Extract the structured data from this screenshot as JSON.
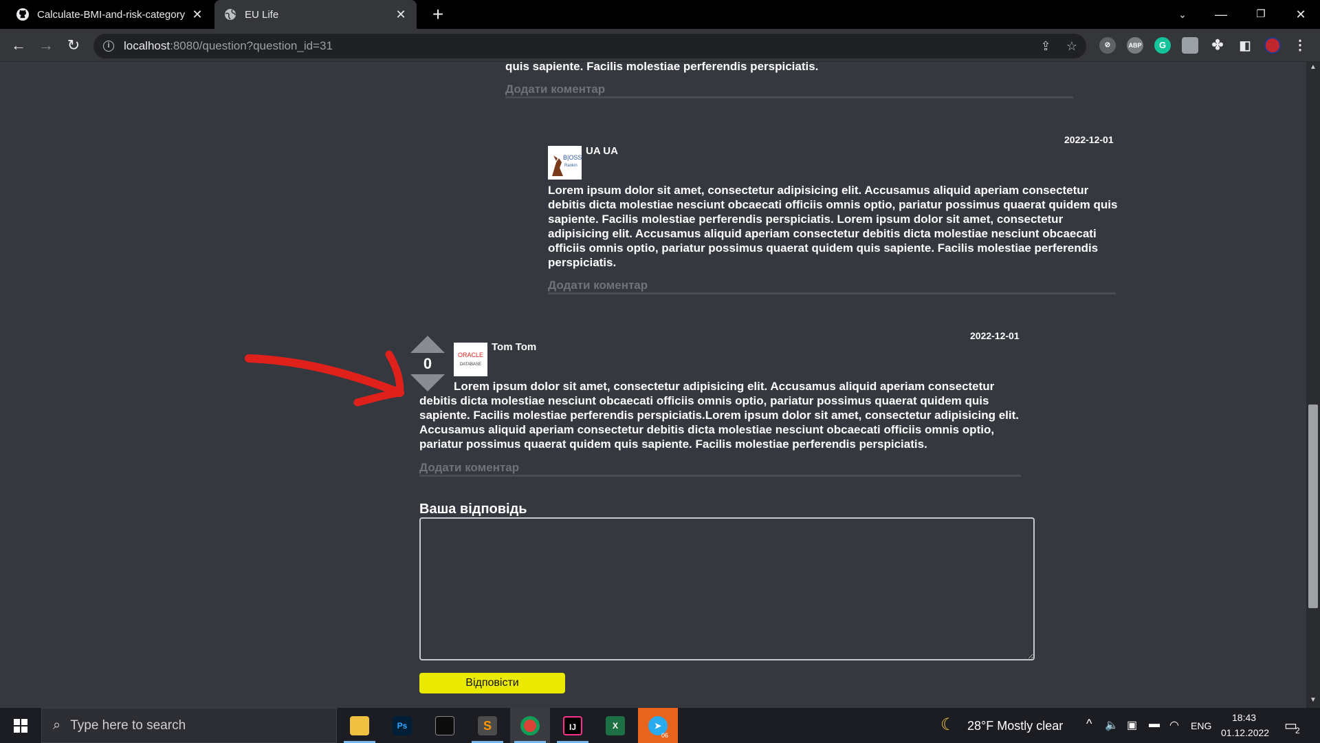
{
  "browser": {
    "tabs": [
      {
        "title": "Calculate-BMI-and-risk-category",
        "icon": "github-icon",
        "active": false
      },
      {
        "title": "EU Life",
        "icon": "globe-icon",
        "active": true
      }
    ],
    "new_tab": "+",
    "url_host": "localhost",
    "url_rest": ":8080/question?question_id=31",
    "extensions": [
      "ABP",
      "G"
    ]
  },
  "page": {
    "top_text_fragment": "quis sapiente. Facilis molestiae perferendis perspiciatis.",
    "top_add_comment": "Додати коментар",
    "answer1": {
      "author": "UA UA",
      "date": "2022-12-01",
      "text": "Lorem ipsum dolor sit amet, consectetur adipisicing elit. Accusamus aliquid aperiam consectetur debitis dicta molestiae nesciunt obcaecati officiis omnis optio, pariatur possimus quaerat quidem quis sapiente. Facilis molestiae perferendis perspiciatis. Lorem ipsum dolor sit amet, consectetur adipisicing elit. Accusamus aliquid aperiam consectetur debitis dicta molestiae nesciunt obcaecati officiis omnis optio, pariatur possimus quaerat quidem quis sapiente. Facilis molestiae perferendis perspiciatis.",
      "add_comment": "Додати коментар"
    },
    "answer2": {
      "author": "Tom Tom",
      "date": "2022-12-01",
      "votes": "0",
      "avatar_text": [
        "ORACLE",
        "DATABASE"
      ],
      "text": "Lorem ipsum dolor sit amet, consectetur adipisicing elit. Accusamus aliquid aperiam consectetur debitis dicta molestiae nesciunt obcaecati officiis omnis optio, pariatur possimus quaerat quidem quis sapiente. Facilis molestiae perferendis perspiciatis.Lorem ipsum dolor sit amet, consectetur adipisicing elit. Accusamus aliquid aperiam consectetur debitis dicta molestiae nesciunt obcaecati officiis omnis optio, pariatur possimus quaerat quidem quis sapiente. Facilis molestiae perferendis perspiciatis.",
      "add_comment": "Додати коментар"
    },
    "your_answer_label": "Ваша відповідь",
    "answer_value": "",
    "submit_label": "Відповісти",
    "annotation_color": "#e0201b",
    "accent_color": "#eaea00"
  },
  "taskbar": {
    "search_placeholder": "Type here to search",
    "weather": "28°F  Mostly clear",
    "language": "ENG",
    "time": "18:43",
    "date": "01.12.2022",
    "notification_count": "2",
    "telegram_badge": "06"
  }
}
